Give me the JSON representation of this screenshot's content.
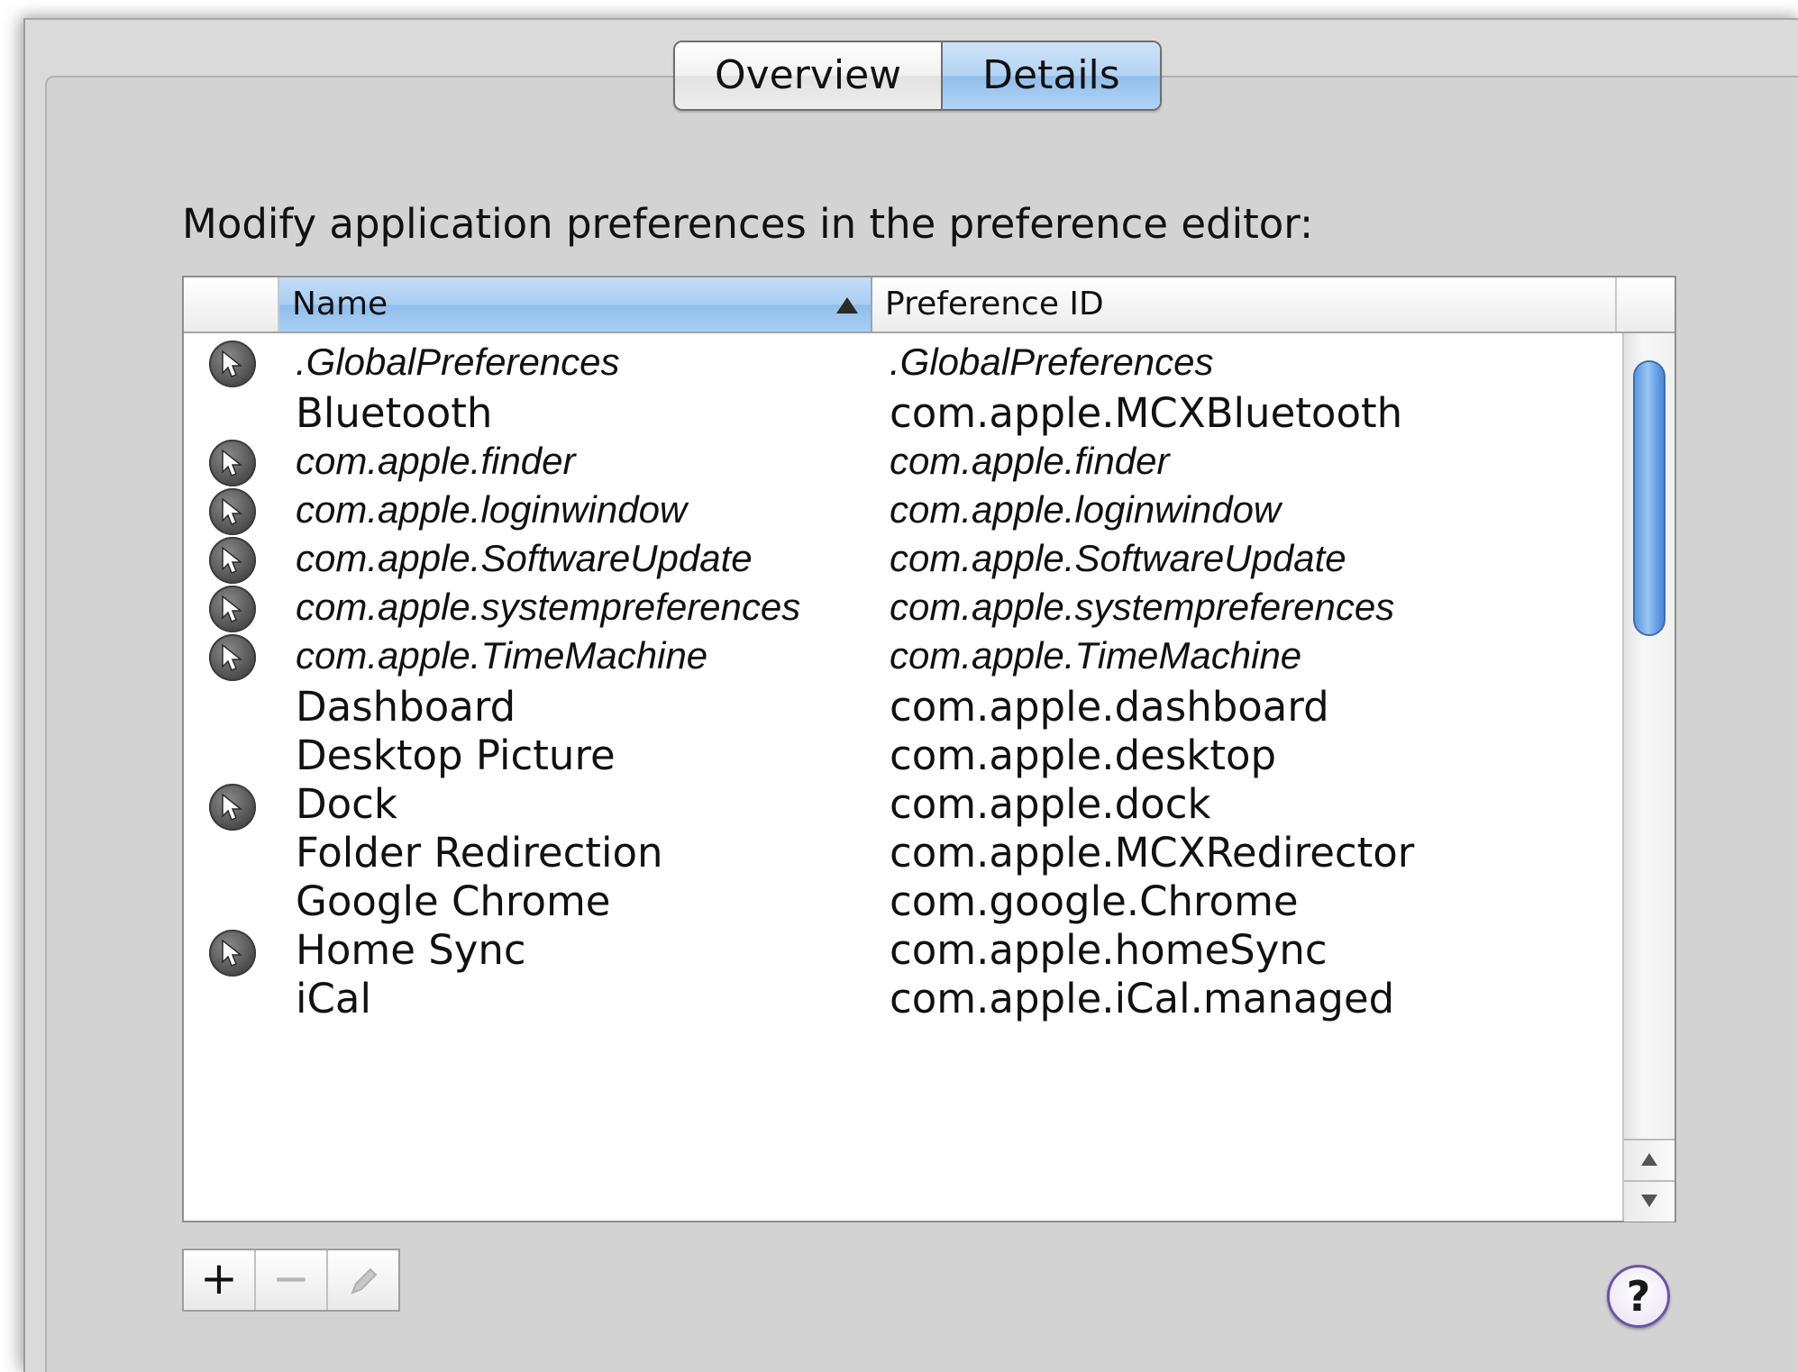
{
  "tabs": [
    {
      "label": "Overview",
      "selected": false
    },
    {
      "label": "Details",
      "selected": true
    }
  ],
  "instruction": "Modify application preferences in the preference editor:",
  "table": {
    "columns": {
      "name": "Name",
      "preference_id": "Preference ID"
    },
    "sort_column": "Name",
    "sort_direction": "ascending",
    "rows": [
      {
        "name": ".GlobalPreferences",
        "preference_id": ".GlobalPreferences",
        "managed_icon": true,
        "italic": true
      },
      {
        "name": "Bluetooth",
        "preference_id": "com.apple.MCXBluetooth",
        "managed_icon": false,
        "italic": false
      },
      {
        "name": "com.apple.finder",
        "preference_id": "com.apple.finder",
        "managed_icon": true,
        "italic": true
      },
      {
        "name": "com.apple.loginwindow",
        "preference_id": "com.apple.loginwindow",
        "managed_icon": true,
        "italic": true
      },
      {
        "name": "com.apple.SoftwareUpdate",
        "preference_id": "com.apple.SoftwareUpdate",
        "managed_icon": true,
        "italic": true
      },
      {
        "name": "com.apple.systempreferences",
        "preference_id": "com.apple.systempreferences",
        "managed_icon": true,
        "italic": true
      },
      {
        "name": "com.apple.TimeMachine",
        "preference_id": "com.apple.TimeMachine",
        "managed_icon": true,
        "italic": true
      },
      {
        "name": "Dashboard",
        "preference_id": "com.apple.dashboard",
        "managed_icon": false,
        "italic": false
      },
      {
        "name": "Desktop Picture",
        "preference_id": "com.apple.desktop",
        "managed_icon": false,
        "italic": false
      },
      {
        "name": "Dock",
        "preference_id": "com.apple.dock",
        "managed_icon": true,
        "italic": false
      },
      {
        "name": "Folder Redirection",
        "preference_id": "com.apple.MCXRedirector",
        "managed_icon": false,
        "italic": false
      },
      {
        "name": "Google Chrome",
        "preference_id": "com.google.Chrome",
        "managed_icon": false,
        "italic": false
      },
      {
        "name": "Home Sync",
        "preference_id": "com.apple.homeSync",
        "managed_icon": true,
        "italic": false
      },
      {
        "name": "iCal",
        "preference_id": "com.apple.iCal.managed",
        "managed_icon": false,
        "italic": false
      }
    ]
  },
  "buttons": {
    "add": "+",
    "remove": "−",
    "edit_icon": "pencil-icon",
    "help": "?"
  },
  "colors": {
    "selected_tab": "#b3d3f3",
    "sorted_header": "#a9cdf2",
    "scroll_thumb": "#6ea6e8",
    "help_border": "#6a54a8"
  }
}
